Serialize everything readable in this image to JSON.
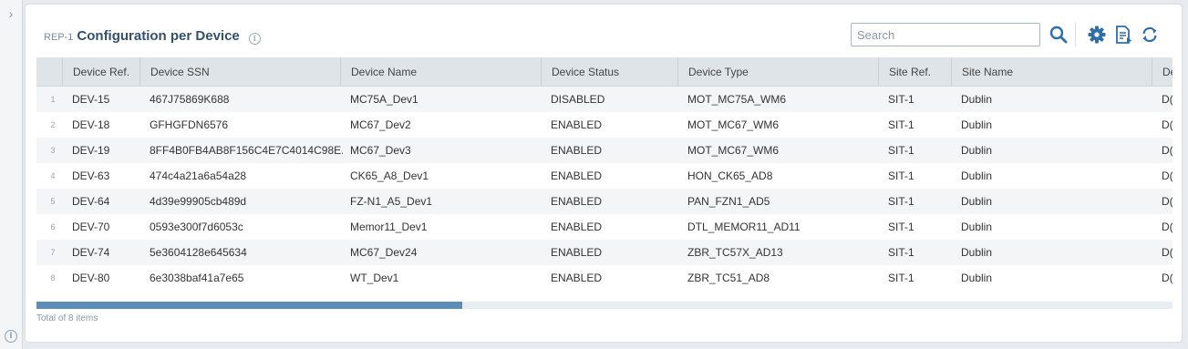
{
  "rail": {
    "toggle_icon": "chevron-right-icon",
    "info_icon": "info-icon"
  },
  "header": {
    "report_code": "REP-1",
    "title": "Configuration per Device",
    "info_icon": "info-icon"
  },
  "search": {
    "placeholder": "Search",
    "value": ""
  },
  "toolbar": {
    "search_icon": "search-icon",
    "settings_icon": "gear-icon",
    "export_icon": "export-file-icon",
    "refresh_icon": "refresh-icon",
    "accent_color": "#2f6ea8"
  },
  "table": {
    "columns": [
      "Device Ref.",
      "Device SSN",
      "Device Name",
      "Device Status",
      "Device Type",
      "Site Ref.",
      "Site Name",
      "De"
    ],
    "rows": [
      {
        "n": "1",
        "ref": "DEV-15",
        "ssn": "467J75869K688",
        "name": "MC75A_Dev1",
        "status": "DISABLED",
        "type": "MOT_MC75A_WM6",
        "site_ref": "SIT-1",
        "site_name": "Dublin",
        "more": "D("
      },
      {
        "n": "2",
        "ref": "DEV-18",
        "ssn": "GFHGFDN6576",
        "name": "MC67_Dev2",
        "status": "ENABLED",
        "type": "MOT_MC67_WM6",
        "site_ref": "SIT-1",
        "site_name": "Dublin",
        "more": "D("
      },
      {
        "n": "3",
        "ref": "DEV-19",
        "ssn": "8FF4B0FB4AB8F156C4E7C4014C98E...",
        "name": "MC67_Dev3",
        "status": "ENABLED",
        "type": "MOT_MC67_WM6",
        "site_ref": "SIT-1",
        "site_name": "Dublin",
        "more": "D("
      },
      {
        "n": "4",
        "ref": "DEV-63",
        "ssn": "474c4a21a6a54a28",
        "name": "CK65_A8_Dev1",
        "status": "ENABLED",
        "type": "HON_CK65_AD8",
        "site_ref": "SIT-1",
        "site_name": "Dublin",
        "more": "D("
      },
      {
        "n": "5",
        "ref": "DEV-64",
        "ssn": "4d39e99905cb489d",
        "name": "FZ-N1_A5_Dev1",
        "status": "ENABLED",
        "type": "PAN_FZN1_AD5",
        "site_ref": "SIT-1",
        "site_name": "Dublin",
        "more": "D("
      },
      {
        "n": "6",
        "ref": "DEV-70",
        "ssn": "0593e300f7d6053c",
        "name": "Memor11_Dev1",
        "status": "ENABLED",
        "type": "DTL_MEMOR11_AD11",
        "site_ref": "SIT-1",
        "site_name": "Dublin",
        "more": "D("
      },
      {
        "n": "7",
        "ref": "DEV-74",
        "ssn": "5e3604128e645634",
        "name": "MC67_Dev24",
        "status": "ENABLED",
        "type": "ZBR_TC57X_AD13",
        "site_ref": "SIT-1",
        "site_name": "Dublin",
        "more": "D("
      },
      {
        "n": "8",
        "ref": "DEV-80",
        "ssn": "6e3038baf41a7e65",
        "name": "WT_Dev1",
        "status": "ENABLED",
        "type": "ZBR_TC51_AD8",
        "site_ref": "SIT-1",
        "site_name": "Dublin",
        "more": "D("
      }
    ]
  },
  "scroll": {
    "visible_fraction": 0.375
  },
  "footer": {
    "total": "Total of 8 items"
  }
}
